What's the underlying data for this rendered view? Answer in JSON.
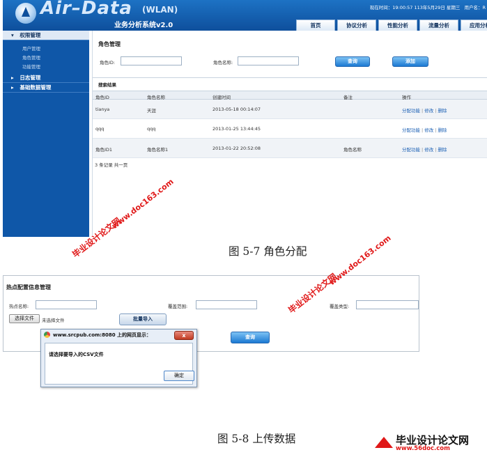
{
  "figure_5_7": {
    "app": {
      "logo_text": "Air–Data",
      "logo_wlan": "(WLAN)",
      "logo_subtitle": "业务分析系统v2.0",
      "top_info": {
        "time_label": "现在时间：",
        "time_value": "19:00:57 113年5月29日 星期三",
        "user_label": "用户名：R"
      },
      "nav_tabs": [
        "首页",
        "协议分析",
        "性能分析",
        "流量分析",
        "应用分析"
      ],
      "sidebar": {
        "groups": [
          {
            "label": "权限管理",
            "open": true,
            "items": [
              "用户管理",
              "角色管理",
              "功能管理"
            ]
          },
          {
            "label": "日志管理",
            "open": false,
            "items": []
          },
          {
            "label": "基础数据管理",
            "open": false,
            "items": []
          }
        ]
      },
      "panel_title": "角色管理",
      "search": {
        "role_id_label": "角色ID:",
        "role_id_value": "",
        "role_name_label": "角色名称:",
        "role_name_value": "",
        "query_button": "查询",
        "add_button": "添加"
      },
      "results_title": "搜索结果",
      "table": {
        "columns": [
          "角色ID",
          "角色名称",
          "创建时间",
          "备注",
          "操作"
        ],
        "rows": [
          {
            "id": "tianya",
            "name": "天涯",
            "created": "2013-05-18 00:14:07",
            "note": ""
          },
          {
            "id": "qqq",
            "name": "qqq",
            "created": "2013-01-25 13:44:45",
            "note": ""
          },
          {
            "id": "角色ID1",
            "name": "角色名称1",
            "created": "2013-01-22 20:52:08",
            "note": "角色名称"
          }
        ],
        "actions": [
          "分配功能",
          "修改",
          "删除"
        ],
        "action_separator": "|"
      },
      "footer": "3 条记录 共一页"
    },
    "caption": "图 5-7    角色分配"
  },
  "figure_5_8": {
    "title": "热点配置信息管理",
    "fields": {
      "hotspot_name_label": "热点名称:",
      "hotspot_name_value": "",
      "coverage_label": "覆盖范围:",
      "coverage_value": "",
      "coverage_type_label": "覆盖类型:",
      "coverage_type_value": ""
    },
    "file_button": "选择文件",
    "file_status": "未选择文件",
    "bulk_import_button": "批量导入",
    "query_button": "查询",
    "dialog": {
      "title": "www.srcpub.com:8080 上的网页显示：",
      "close": "x",
      "message": "请选择要导入的CSV文件",
      "ok_button": "确定"
    },
    "caption": "图 5-8  上传数据"
  },
  "watermarks": {
    "cn_text": "毕业设计论文网",
    "url_text": "www.doc163.com",
    "logo_cn": "毕业设计论文网",
    "logo_url": "www.56doc.com",
    "color": "#e01818"
  }
}
